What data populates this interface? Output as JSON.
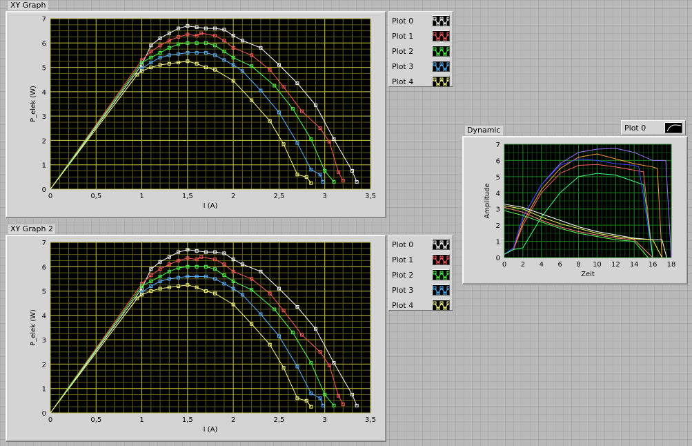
{
  "graphs": [
    {
      "title": "XY Graph",
      "xlabel": "I (A)",
      "ylabel": "P_elek (W)",
      "xticks": [
        "0",
        "0,5",
        "1",
        "1,5",
        "2",
        "2,5",
        "3",
        "3,5"
      ],
      "yticks": [
        "0",
        "1",
        "2",
        "3",
        "4",
        "5",
        "6",
        "7"
      ],
      "legend": [
        "Plot 0",
        "Plot 1",
        "Plot 2",
        "Plot 3",
        "Plot 4"
      ]
    },
    {
      "title": "XY Graph 2",
      "xlabel": "I (A)",
      "ylabel": "P_elek (W)",
      "xticks": [
        "0",
        "0,5",
        "1",
        "1,5",
        "2",
        "2,5",
        "3",
        "3,5"
      ],
      "yticks": [
        "0",
        "1",
        "2",
        "3",
        "4",
        "5",
        "6",
        "7"
      ],
      "legend": [
        "Plot 0",
        "Plot 1",
        "Plot 2",
        "Plot 3",
        "Plot 4"
      ]
    }
  ],
  "dynamic": {
    "title": "Dynamic",
    "xlabel": "Zeit",
    "ylabel": "Amplitude",
    "xticks": [
      "0",
      "2",
      "4",
      "6",
      "8",
      "10",
      "12",
      "14",
      "16",
      "18"
    ],
    "yticks": [
      "0",
      "1",
      "2",
      "3",
      "4",
      "5",
      "6",
      "7"
    ],
    "legend": [
      "Plot 0"
    ]
  },
  "colors": {
    "plot_bg": "#000000",
    "grid_major": "#b8b840",
    "grid_minor": "#5d5d1e",
    "dyn_grid_major": "#1e7a1e",
    "dyn_grid_minor": "#0e3f0e",
    "series": [
      "#ffffff",
      "#ff5a5a",
      "#4cff4c",
      "#5ab4ff",
      "#ffff88"
    ]
  },
  "chart_data": [
    {
      "type": "scatter",
      "title": "XY Graph",
      "xlabel": "I (A)",
      "ylabel": "P_elek (W)",
      "xlim": [
        0,
        3.5
      ],
      "ylim": [
        0,
        7
      ],
      "grid": true,
      "legend_position": "right-top",
      "series": [
        {
          "name": "Plot 0",
          "x": [
            0,
            1.0,
            1.1,
            1.2,
            1.3,
            1.4,
            1.5,
            1.6,
            1.7,
            1.8,
            1.9,
            2.0,
            2.1,
            2.3,
            2.5,
            2.7,
            2.9,
            3.1,
            3.3,
            3.35
          ],
          "y": [
            0,
            5.1,
            5.9,
            6.2,
            6.4,
            6.6,
            6.7,
            6.65,
            6.6,
            6.6,
            6.55,
            6.3,
            6.1,
            5.8,
            5.1,
            4.35,
            3.45,
            2.05,
            0.75,
            0.3
          ]
        },
        {
          "name": "Plot 1",
          "x": [
            0,
            1.0,
            1.1,
            1.2,
            1.3,
            1.4,
            1.5,
            1.6,
            1.65,
            1.8,
            1.9,
            2.0,
            2.2,
            2.4,
            2.55,
            2.75,
            2.95,
            3.05,
            3.15,
            3.2
          ],
          "y": [
            0,
            5.3,
            5.65,
            5.9,
            6.1,
            6.25,
            6.35,
            6.3,
            6.4,
            6.3,
            6.1,
            5.8,
            5.5,
            4.9,
            4.2,
            3.2,
            2.5,
            1.95,
            0.7,
            0.35
          ]
        },
        {
          "name": "Plot 2",
          "x": [
            0,
            1.0,
            1.1,
            1.2,
            1.3,
            1.4,
            1.5,
            1.6,
            1.7,
            1.8,
            1.9,
            2.0,
            2.2,
            2.45,
            2.65,
            2.85,
            3.0,
            3.1
          ],
          "y": [
            0,
            5.2,
            5.4,
            5.6,
            5.8,
            5.95,
            6.0,
            6.0,
            6.0,
            5.9,
            5.65,
            5.4,
            5.05,
            4.25,
            3.3,
            2.05,
            0.75,
            0.3
          ]
        },
        {
          "name": "Plot 3",
          "x": [
            0,
            1.0,
            1.1,
            1.2,
            1.3,
            1.4,
            1.5,
            1.6,
            1.7,
            1.8,
            1.9,
            2.0,
            2.1,
            2.3,
            2.5,
            2.7,
            2.85,
            2.95,
            2.98
          ],
          "y": [
            0,
            4.95,
            5.2,
            5.4,
            5.5,
            5.55,
            5.6,
            5.6,
            5.6,
            5.5,
            5.3,
            5.1,
            4.85,
            4.05,
            3.15,
            1.9,
            0.8,
            0.6,
            0.3
          ]
        },
        {
          "name": "Plot 4",
          "x": [
            0,
            0.95,
            1.0,
            1.1,
            1.2,
            1.3,
            1.4,
            1.5,
            1.6,
            1.7,
            1.8,
            2.0,
            2.2,
            2.4,
            2.55,
            2.7,
            2.8,
            2.85
          ],
          "y": [
            0,
            4.7,
            4.85,
            5.0,
            5.1,
            5.15,
            5.2,
            5.25,
            5.15,
            5.0,
            4.9,
            4.45,
            3.65,
            2.8,
            1.85,
            0.6,
            0.5,
            0.25
          ]
        }
      ]
    },
    {
      "type": "scatter",
      "title": "XY Graph 2",
      "xlabel": "I (A)",
      "ylabel": "P_elek (W)",
      "xlim": [
        0,
        3.5
      ],
      "ylim": [
        0,
        7
      ],
      "grid": true,
      "legend_position": "right-top",
      "series": [
        {
          "name": "Plot 0",
          "x": [
            0,
            1.0,
            1.1,
            1.2,
            1.3,
            1.4,
            1.5,
            1.6,
            1.7,
            1.8,
            1.9,
            2.0,
            2.1,
            2.3,
            2.5,
            2.7,
            2.9,
            3.1,
            3.3,
            3.35
          ],
          "y": [
            0,
            5.1,
            5.9,
            6.2,
            6.4,
            6.6,
            6.7,
            6.65,
            6.6,
            6.6,
            6.55,
            6.3,
            6.1,
            5.8,
            5.1,
            4.35,
            3.45,
            2.05,
            0.75,
            0.3
          ]
        },
        {
          "name": "Plot 1",
          "x": [
            0,
            1.0,
            1.1,
            1.2,
            1.3,
            1.4,
            1.5,
            1.6,
            1.65,
            1.8,
            1.9,
            2.0,
            2.2,
            2.4,
            2.55,
            2.75,
            2.95,
            3.05,
            3.15,
            3.2
          ],
          "y": [
            0,
            5.3,
            5.65,
            5.9,
            6.1,
            6.25,
            6.35,
            6.3,
            6.4,
            6.3,
            6.1,
            5.8,
            5.5,
            4.9,
            4.2,
            3.2,
            2.5,
            1.95,
            0.7,
            0.35
          ]
        },
        {
          "name": "Plot 2",
          "x": [
            0,
            1.0,
            1.1,
            1.2,
            1.3,
            1.4,
            1.5,
            1.6,
            1.7,
            1.8,
            1.9,
            2.0,
            2.2,
            2.45,
            2.65,
            2.85,
            3.0,
            3.1
          ],
          "y": [
            0,
            5.2,
            5.4,
            5.6,
            5.8,
            5.95,
            6.0,
            6.0,
            6.0,
            5.9,
            5.65,
            5.4,
            5.05,
            4.25,
            3.3,
            2.05,
            0.75,
            0.3
          ]
        },
        {
          "name": "Plot 3",
          "x": [
            0,
            1.0,
            1.1,
            1.2,
            1.3,
            1.4,
            1.5,
            1.6,
            1.7,
            1.8,
            1.9,
            2.0,
            2.1,
            2.3,
            2.5,
            2.7,
            2.85,
            2.95,
            2.98
          ],
          "y": [
            0,
            4.95,
            5.2,
            5.4,
            5.5,
            5.55,
            5.6,
            5.6,
            5.6,
            5.5,
            5.3,
            5.1,
            4.85,
            4.05,
            3.15,
            1.9,
            0.8,
            0.6,
            0.3
          ]
        },
        {
          "name": "Plot 4",
          "x": [
            0,
            0.95,
            1.0,
            1.1,
            1.2,
            1.3,
            1.4,
            1.5,
            1.6,
            1.7,
            1.8,
            2.0,
            2.2,
            2.4,
            2.55,
            2.7,
            2.8,
            2.85
          ],
          "y": [
            0,
            4.7,
            4.85,
            5.0,
            5.1,
            5.15,
            5.2,
            5.25,
            5.15,
            5.0,
            4.9,
            4.45,
            3.65,
            2.8,
            1.85,
            0.6,
            0.5,
            0.25
          ]
        }
      ]
    },
    {
      "type": "line",
      "title": "Dynamic",
      "xlabel": "Zeit",
      "ylabel": "Amplitude",
      "xlim": [
        0,
        18
      ],
      "ylim": [
        0,
        7
      ],
      "grid": true,
      "legend_position": "top-right",
      "series": [
        {
          "color": "#a070ff",
          "x": [
            0,
            1,
            2,
            4,
            6,
            8,
            10,
            12,
            14,
            16,
            17,
            17.4,
            18
          ],
          "y": [
            0.2,
            0.6,
            2.5,
            4.5,
            5.8,
            6.5,
            6.7,
            6.75,
            6.5,
            6.0,
            6.0,
            6.0,
            0
          ]
        },
        {
          "color": "#ff9a40",
          "x": [
            0,
            1,
            2,
            4,
            6,
            8,
            10,
            12,
            14,
            16,
            16.5,
            17
          ],
          "y": [
            0.2,
            0.5,
            2.2,
            4.2,
            5.5,
            6.2,
            6.4,
            6.1,
            5.8,
            5.6,
            5.5,
            0
          ]
        },
        {
          "color": "#ff6060",
          "x": [
            0,
            1,
            2,
            4,
            6,
            8,
            10,
            12,
            14,
            15,
            16
          ],
          "y": [
            0.2,
            0.5,
            2.0,
            4.0,
            5.2,
            5.7,
            5.75,
            5.6,
            5.4,
            5.3,
            0
          ]
        },
        {
          "color": "#4040ff",
          "x": [
            0,
            1,
            2,
            4,
            6,
            8,
            10,
            12,
            14,
            14.5,
            16
          ],
          "y": [
            0.2,
            0.6,
            2.5,
            4.5,
            5.7,
            6.1,
            6.0,
            5.8,
            5.7,
            5.6,
            0
          ]
        },
        {
          "color": "#40ff80",
          "x": [
            0,
            1,
            2,
            4,
            6,
            8,
            10,
            12,
            14,
            15,
            16
          ],
          "y": [
            0.2,
            0.5,
            0.6,
            2.5,
            4.0,
            5.0,
            5.2,
            5.1,
            4.7,
            4.5,
            0
          ]
        },
        {
          "color": "#ffffff",
          "x": [
            0,
            2,
            4,
            6,
            8,
            10,
            12,
            14,
            16,
            17,
            17.5
          ],
          "y": [
            3.3,
            3.1,
            2.7,
            2.3,
            1.9,
            1.6,
            1.4,
            1.2,
            1.1,
            1.1,
            0
          ]
        },
        {
          "color": "#ffff60",
          "x": [
            0,
            2,
            4,
            6,
            8,
            10,
            12,
            14,
            16,
            17
          ],
          "y": [
            3.2,
            3.0,
            2.5,
            2.1,
            1.8,
            1.5,
            1.3,
            1.15,
            1.1,
            0
          ]
        },
        {
          "color": "#ff8080",
          "x": [
            0,
            2,
            4,
            6,
            8,
            10,
            12,
            14,
            16
          ],
          "y": [
            3.1,
            2.8,
            2.3,
            1.9,
            1.6,
            1.4,
            1.2,
            1.1,
            0
          ]
        },
        {
          "color": "#60ff60",
          "x": [
            0,
            2,
            4,
            6,
            8,
            10,
            12,
            14,
            15.5
          ],
          "y": [
            2.9,
            2.6,
            2.2,
            1.8,
            1.5,
            1.3,
            1.1,
            1.0,
            0
          ]
        }
      ]
    }
  ]
}
